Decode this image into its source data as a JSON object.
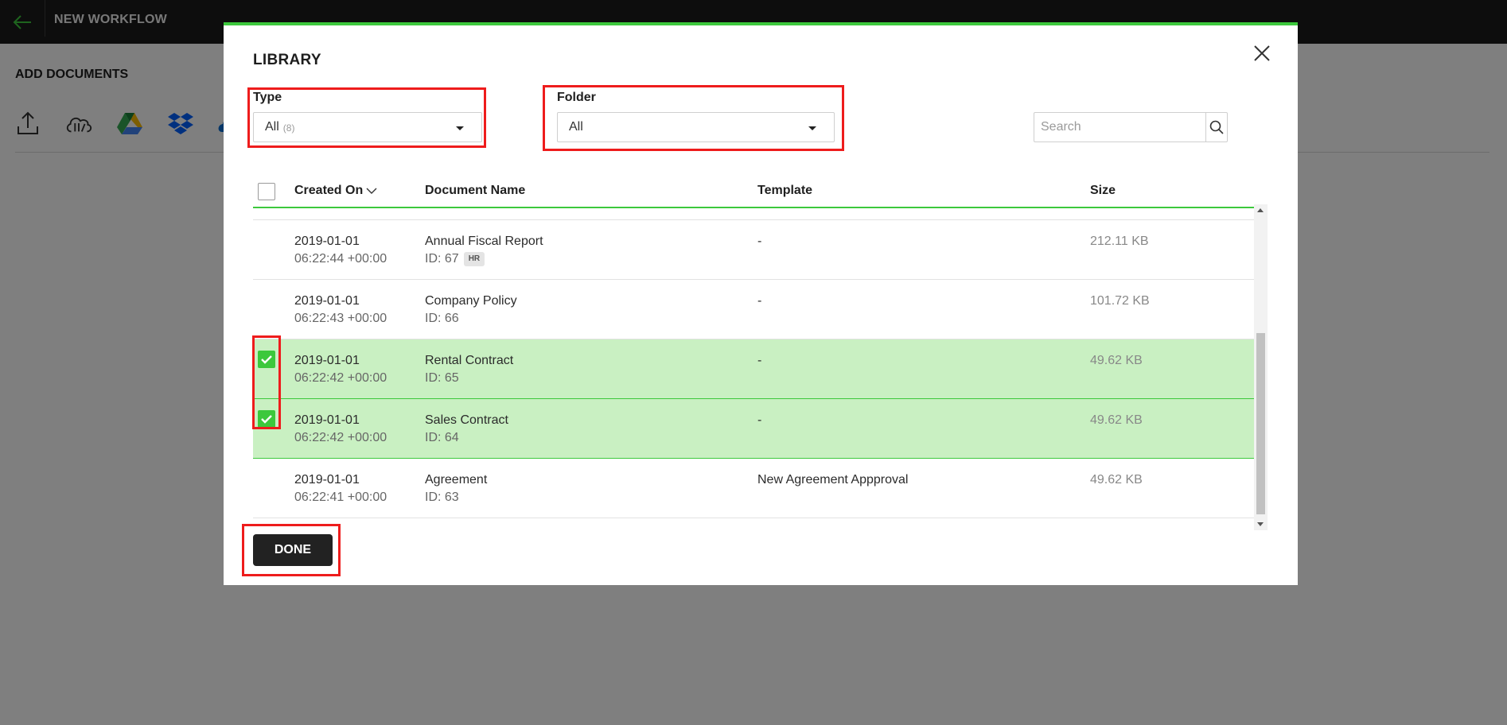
{
  "app": {
    "title": "NEW WORKFLOW",
    "section_title": "ADD DOCUMENTS",
    "sources": [
      "upload-icon",
      "library-cloud-icon",
      "google-drive-icon",
      "dropbox-icon",
      "onedrive-icon"
    ]
  },
  "modal": {
    "title": "LIBRARY",
    "filters": {
      "type": {
        "label": "Type",
        "value": "All",
        "count": "(8)"
      },
      "folder": {
        "label": "Folder",
        "value": "All"
      }
    },
    "search": {
      "placeholder": "Search"
    },
    "columns": {
      "select_all": "",
      "created_on": "Created On",
      "document_name": "Document Name",
      "template": "Template",
      "size": "Size"
    },
    "rows": [
      {
        "date": "2019-01-01",
        "time": "06:22:44 +00:00",
        "name": "Annual Fiscal Report",
        "id": "ID: 67",
        "badge": "HR",
        "template": "-",
        "size": "212.11 KB",
        "selected": false
      },
      {
        "date": "2019-01-01",
        "time": "06:22:43 +00:00",
        "name": "Company Policy",
        "id": "ID: 66",
        "badge": "",
        "template": "-",
        "size": "101.72 KB",
        "selected": false
      },
      {
        "date": "2019-01-01",
        "time": "06:22:42 +00:00",
        "name": "Rental Contract",
        "id": "ID: 65",
        "badge": "",
        "template": "-",
        "size": "49.62 KB",
        "selected": true
      },
      {
        "date": "2019-01-01",
        "time": "06:22:42 +00:00",
        "name": "Sales Contract",
        "id": "ID: 64",
        "badge": "",
        "template": "-",
        "size": "49.62 KB",
        "selected": true
      },
      {
        "date": "2019-01-01",
        "time": "06:22:41 +00:00",
        "name": "Agreement",
        "id": "ID: 63",
        "badge": "",
        "template": "New Agreement Appproval",
        "size": "49.62 KB",
        "selected": false
      }
    ],
    "done_label": "DONE"
  },
  "colors": {
    "accent": "#3cc83c",
    "selected_row": "#c9f0c2",
    "annotation": "#ee1c1c",
    "topbar": "#1a1a1a"
  }
}
